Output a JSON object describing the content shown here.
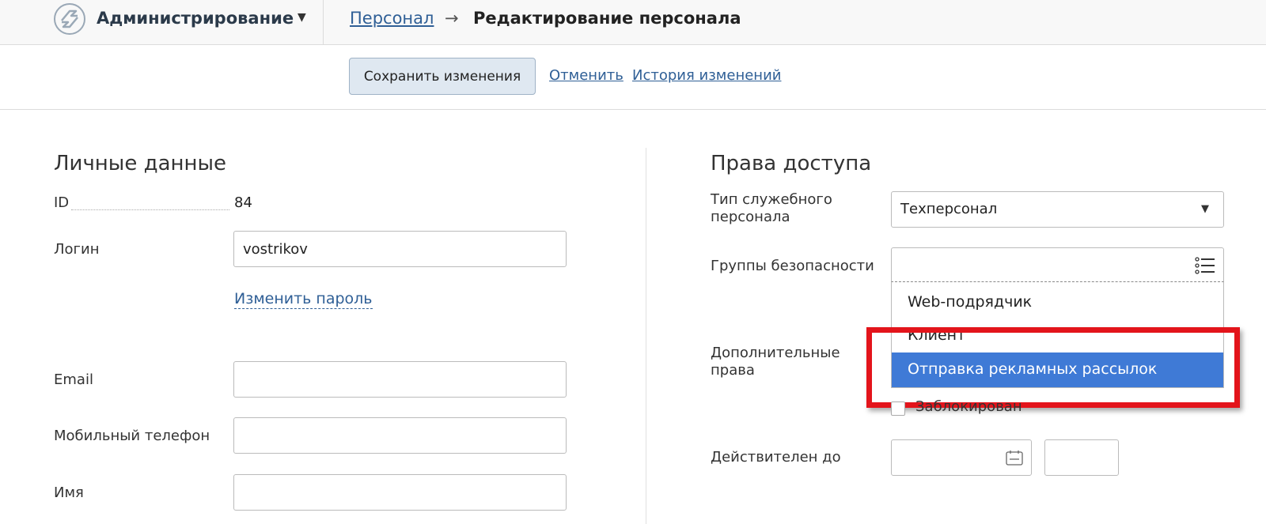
{
  "header": {
    "app_title": "Администрирование",
    "app_caret": "▼",
    "breadcrumb_link": "Персонал",
    "breadcrumb_arrow": "→",
    "breadcrumb_current": "Редактирование персонала"
  },
  "toolbar": {
    "save_label": "Сохранить изменения",
    "cancel_label": "Отменить",
    "history_label": "История изменений"
  },
  "personal": {
    "title": "Личные данные",
    "id_label": "ID",
    "id_value": "84",
    "login_label": "Логин",
    "login_value": "vostrikov",
    "change_password": "Изменить пароль",
    "email_label": "Email",
    "email_value": "",
    "mobile_label": "Мобильный телефон",
    "mobile_value": "",
    "name_label": "Имя",
    "name_value": ""
  },
  "access": {
    "title": "Права доступа",
    "staff_type_label_1": "Тип служебного",
    "staff_type_label_2": "персонала",
    "staff_type_value": "Техперсонал",
    "security_groups_label": "Группы безопасности",
    "security_groups_options": [
      {
        "label": "Web-подрядчик",
        "selected": false
      },
      {
        "label": "Клиент",
        "selected": false
      },
      {
        "label": "Отправка рекламных рассылок",
        "selected": true
      }
    ],
    "extra_rights_label_1": "Дополнительные",
    "extra_rights_label_2": "права",
    "blocked_label": "Заблокирован",
    "valid_until_label": "Действителен до"
  },
  "colors": {
    "link": "#2f5f96",
    "selection": "#3f7ad6",
    "highlight": "#e3141b",
    "save_button_bg": "#dfe8f1"
  },
  "icons": {
    "logo": "refresh-arrows-logo",
    "list": "list-icon",
    "calendar": "calendar-icon"
  }
}
